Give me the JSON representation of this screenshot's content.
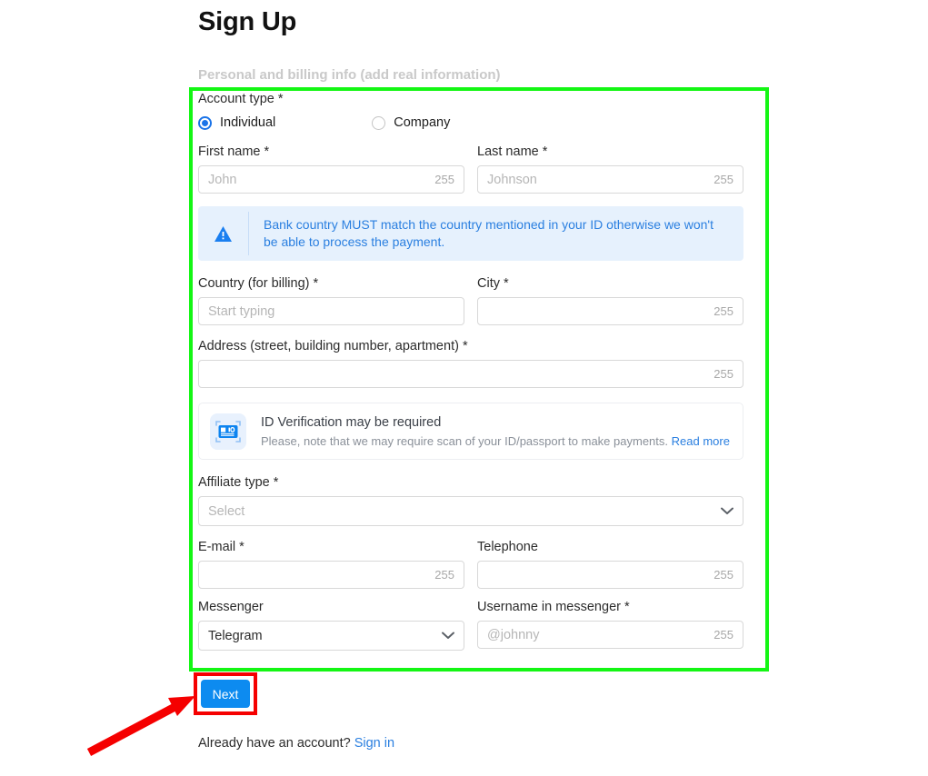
{
  "header": {
    "title": "Sign Up",
    "subtitle": "Personal and billing info (add real information)"
  },
  "form": {
    "account_type": {
      "label": "Account type *",
      "options": [
        {
          "label": "Individual",
          "selected": true
        },
        {
          "label": "Company",
          "selected": false
        }
      ]
    },
    "first_name": {
      "label": "First name *",
      "placeholder": "John",
      "value": "",
      "counter": "255"
    },
    "last_name": {
      "label": "Last name *",
      "placeholder": "Johnson",
      "value": "",
      "counter": "255"
    },
    "bank_alert": {
      "icon": "warning-triangle-icon",
      "text": "Bank country MUST match the country mentioned in your ID otherwise we won't be able to process the payment."
    },
    "country": {
      "label": "Country (for billing) *",
      "placeholder": "Start typing",
      "value": ""
    },
    "city": {
      "label": "City *",
      "placeholder": "",
      "value": "",
      "counter": "255"
    },
    "address": {
      "label": "Address (street, building number, apartment) *",
      "placeholder": "",
      "value": "",
      "counter": "255"
    },
    "id_verification": {
      "icon": "id-card-scan-icon",
      "title": "ID Verification may be required",
      "subtitle": "Please, note that we may require scan of your ID/passport to make payments.",
      "link_label": "Read more"
    },
    "affiliate_type": {
      "label": "Affiliate type *",
      "placeholder": "Select",
      "value": ""
    },
    "email": {
      "label": "E-mail *",
      "placeholder": "",
      "value": "",
      "counter": "255"
    },
    "telephone": {
      "label": "Telephone",
      "placeholder": "",
      "value": "",
      "counter": "255"
    },
    "messenger": {
      "label": "Messenger",
      "value": "Telegram"
    },
    "messenger_username": {
      "label": "Username in messenger *",
      "placeholder": "@johnny",
      "value": "",
      "counter": "255"
    }
  },
  "actions": {
    "next_label": "Next",
    "footer_prompt": "Already have an account?",
    "sign_in_label": "Sign in"
  },
  "annotations": {
    "highlight_box_color": "#14f614",
    "target_box_color": "#f50000",
    "arrow_color": "#f50000"
  },
  "colors": {
    "accent_blue": "#0d8bf0",
    "link_blue": "#2a7fe0",
    "alert_bg": "#e6f1fd",
    "border_gray": "#d8d8d8",
    "placeholder_gray": "#b6b6b6"
  }
}
